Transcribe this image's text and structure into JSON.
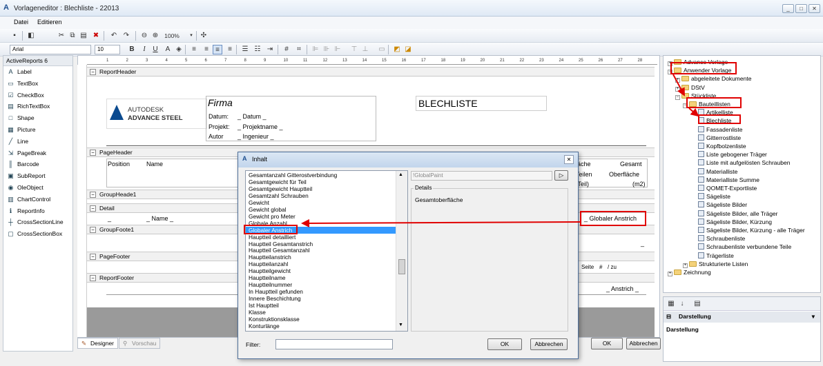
{
  "window": {
    "title": "Vorlageneditor : Blechliste - 22013",
    "controls": [
      "_",
      "□",
      "✕"
    ]
  },
  "menu": [
    "Datei",
    "Editieren"
  ],
  "toolbar": {
    "zoom": "100%",
    "font": "Arial",
    "size": "10",
    "bold": "B",
    "italic": "I",
    "underline": "U"
  },
  "toolbox": {
    "header": "ActiveReports 6",
    "items": [
      "Label",
      "TextBox",
      "CheckBox",
      "RichTextBox",
      "Shape",
      "Picture",
      "Line",
      "PageBreak",
      "Barcode",
      "SubReport",
      "OleObject",
      "ChartControl",
      "ReportInfo",
      "CrossSectionLine",
      "CrossSectionBox"
    ]
  },
  "ruler": [
    "1",
    "2",
    "3",
    "4",
    "5",
    "6",
    "7",
    "8",
    "9",
    "10",
    "11",
    "12",
    "13",
    "14",
    "15",
    "16",
    "17",
    "18",
    "19",
    "20",
    "21",
    "22",
    "23",
    "24",
    "25",
    "26",
    "27",
    "28"
  ],
  "bands": {
    "report_header": "ReportHeader",
    "page_header": "PageHeader",
    "group_header": "GroupHeade1",
    "detail": "Detail",
    "group_footer": "GroupFoote1",
    "page_footer": "PageFooter",
    "report_footer": "ReportFooter"
  },
  "report": {
    "logo_line1": "AUTODESK",
    "logo_line2": "ADVANCE STEEL",
    "firma": "Firma",
    "title": "BLECHLISTE",
    "datum_label": "Datum:",
    "datum_value": "_ Datum _",
    "projekt_label": "Projekt:",
    "projekt_value": "_ Projektname _",
    "autor_label": "Autor",
    "autor_value": "_ Ingenieur _",
    "col_position": "Position",
    "col_name": "Name",
    "col_flaeche": "läche",
    "col_gesamt": "Gesamt",
    "col_teilen": "Teilen",
    "col_oberflaeche": "Oberfläche",
    "col_perteil": "/Teil)",
    "col_m2": "(m2)",
    "detail_name": "_ Name _",
    "detail_underscore": "_",
    "global_anstrich": "_ Globaler Anstrich",
    "seite": "Seite",
    "hash": "#",
    "zu": "/ zu",
    "footer_anstrich": "_ Anstrich _",
    "gf_underscore": "_"
  },
  "tabs": {
    "designer": "Designer",
    "preview": "Vorschau"
  },
  "tree": {
    "items": [
      {
        "label": "Advance Vorlage",
        "type": "folder",
        "level": 0
      },
      {
        "label": "Anwender Vorlage",
        "type": "folder",
        "level": 0
      },
      {
        "label": "abgeleitete Dokumente",
        "type": "folder",
        "level": 1
      },
      {
        "label": "DStV",
        "type": "folder",
        "level": 1
      },
      {
        "label": "Stückliste",
        "type": "folder",
        "level": 1
      },
      {
        "label": "Bauteillisten",
        "type": "folder",
        "level": 2
      },
      {
        "label": "Artikelliste",
        "type": "doc",
        "level": 3
      },
      {
        "label": "Blechliste",
        "type": "doc",
        "level": 3
      },
      {
        "label": "Fassadenliste",
        "type": "doc",
        "level": 3
      },
      {
        "label": "Gitterrostliste",
        "type": "doc",
        "level": 3
      },
      {
        "label": "Kopfbolzenliste",
        "type": "doc",
        "level": 3
      },
      {
        "label": "Liste gebogener Träger",
        "type": "doc",
        "level": 3
      },
      {
        "label": "Liste mit aufgelösten Schrauben",
        "type": "doc",
        "level": 3
      },
      {
        "label": "Materialliste",
        "type": "doc",
        "level": 3
      },
      {
        "label": "Materialliste Summe",
        "type": "doc",
        "level": 3
      },
      {
        "label": "QOMET-Exportliste",
        "type": "doc",
        "level": 3
      },
      {
        "label": "Sägeliste",
        "type": "doc",
        "level": 3
      },
      {
        "label": "Sägeliste Bilder",
        "type": "doc",
        "level": 3
      },
      {
        "label": "Sägeliste Bilder, alle Träger",
        "type": "doc",
        "level": 3
      },
      {
        "label": "Sägeliste Bilder, Kürzung",
        "type": "doc",
        "level": 3
      },
      {
        "label": "Sägeliste Bilder, Kürzung - alle Träger",
        "type": "doc",
        "level": 3
      },
      {
        "label": "Schraubenliste",
        "type": "doc",
        "level": 3
      },
      {
        "label": "Schraubenliste verbundene Teile",
        "type": "doc",
        "level": 3
      },
      {
        "label": "Trägerliste",
        "type": "doc",
        "level": 3
      },
      {
        "label": "Strukturierte Listen",
        "type": "folder",
        "level": 2
      },
      {
        "label": "Zeichnung",
        "type": "folder",
        "level": 0
      }
    ]
  },
  "properties": {
    "section": "Darstellung",
    "content": "Darstellung"
  },
  "dialog": {
    "title": "Inhalt",
    "path": "!GlobalPaint",
    "details_label": "Details",
    "details_text": "Gesamtoberfläche",
    "filter_label": "Filter:",
    "filter_value": "",
    "ok": "OK",
    "cancel": "Abbrechen",
    "selected": "Globaler Anstrich",
    "items": [
      "Gesamtanzahl Gitterostverbindung",
      "Gesamtgewicht für Teil",
      "Gesamtgewicht Hauptteil",
      "Gesamtzahl Schrauben",
      "Gewicht",
      "Gewicht global",
      "Gewicht pro Meter",
      "Globale Anzahl",
      "Globaler Anstrich",
      "Hauptteil detailliert",
      "Hauptteil Gesamtanstrich",
      "Hauptteil Gesamtanzahl",
      "Hauptteilanstrich",
      "Hauptteilanzahl",
      "Hauptteilgewicht",
      "Hauptteilname",
      "Hauptteilnummer",
      "In Hauptteil gefunden",
      "Innere Beschichtung",
      "Ist Hauptteil",
      "Klasse",
      "Konstruktionsklasse",
      "Konturlänge"
    ]
  },
  "bottom_buttons": {
    "ok": "OK",
    "cancel": "Abbrechen"
  }
}
